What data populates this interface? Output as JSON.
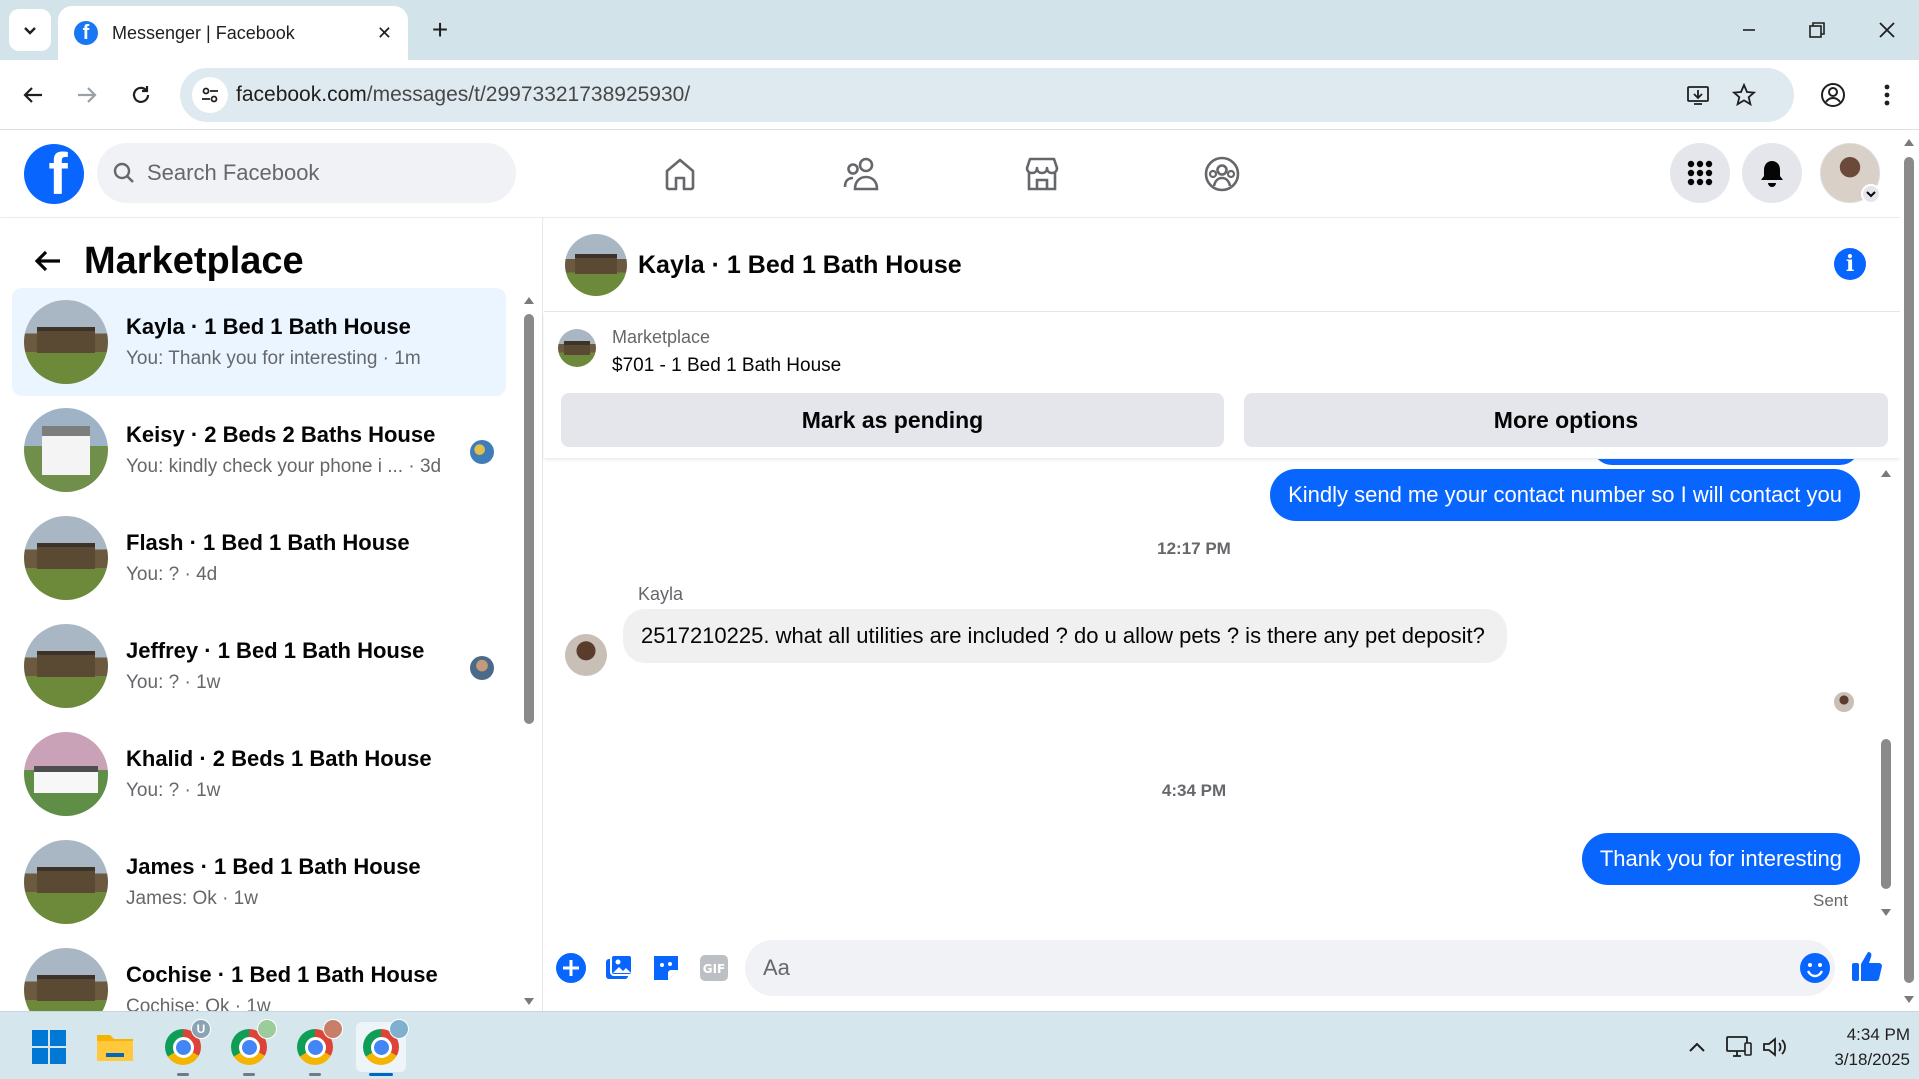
{
  "browser": {
    "tab_title": "Messenger | Facebook",
    "url_host": "facebook.com",
    "url_path": "/messages/t/29973321738925930/"
  },
  "fb": {
    "search_placeholder": "Search Facebook"
  },
  "sidebar": {
    "title": "Marketplace",
    "conversations": [
      {
        "name": "Kayla · 1 Bed 1 Bath House",
        "snippet": "You: Thank you for interesting · 1m"
      },
      {
        "name": "Keisy · 2 Beds 2 Baths House",
        "snippet": "You: kindly check your phone i ...  · 3d"
      },
      {
        "name": "Flash · 1 Bed 1 Bath House",
        "snippet": "You: ? · 4d"
      },
      {
        "name": "Jeffrey · 1 Bed 1 Bath House",
        "snippet": "You: ? · 1w"
      },
      {
        "name": "Khalid · 2 Beds 1 Bath House",
        "snippet": "You: ? · 1w"
      },
      {
        "name": "James · 1 Bed 1 Bath House",
        "snippet": "James: Ok · 1w"
      },
      {
        "name": "Cochise · 1 Bed 1 Bath House",
        "snippet": "Cochise: Ok · 1w"
      }
    ]
  },
  "chat": {
    "title": "Kayla · 1 Bed 1 Bath House",
    "listing_category": "Marketplace",
    "listing_price": "$701 - 1 Bed 1 Bath House",
    "mark_pending_label": "Mark as pending",
    "more_options_label": "More options",
    "messages": {
      "out1": "Kindly send me your contact number so I will contact you",
      "time1": "12:17 PM",
      "sender": "Kayla",
      "in1": "2517210225. what all utilities are included ? do u allow pets ? is there any pet deposit?",
      "time2": "4:34 PM",
      "out2": "Thank you for interesting",
      "status": "Sent"
    },
    "composer_placeholder": "Aa"
  },
  "taskbar": {
    "time": "4:34 PM",
    "date": "3/18/2025",
    "chrome_badges": [
      "U",
      "",
      "",
      ""
    ]
  }
}
